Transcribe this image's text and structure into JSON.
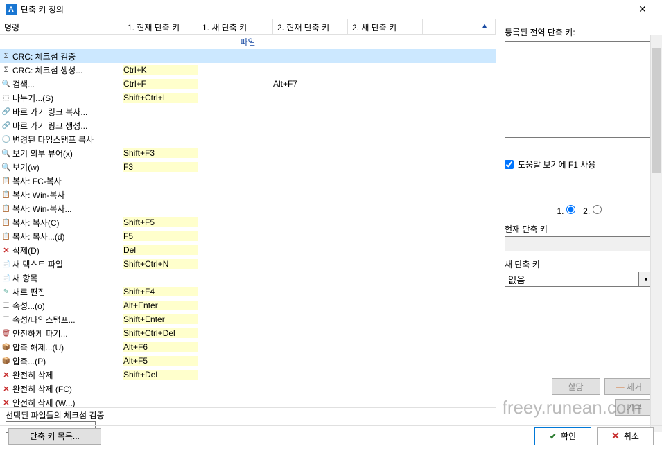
{
  "window": {
    "title": "단축 키 정의"
  },
  "headers": {
    "name": "명령",
    "c1current": "1. 현재 단축 키",
    "c1new": "1. 새 단축 키",
    "c2current": "2. 현재 단축 키",
    "c2new": "2. 새 단축 키"
  },
  "group": "파일",
  "rows": [
    {
      "icon": "sigma",
      "name": "CRC: 체크섬 검증",
      "c1c": "",
      "c1n": "",
      "c2c": "",
      "c2n": "",
      "selected": true
    },
    {
      "icon": "sigma",
      "name": "CRC: 체크섬 생성...",
      "c1c": "Ctrl+K",
      "c1n": "",
      "c2c": "",
      "c2n": ""
    },
    {
      "icon": "search",
      "name": "검색...",
      "c1c": "Ctrl+F",
      "c1n": "",
      "c2c": "Alt+F7",
      "c2n": ""
    },
    {
      "icon": "split",
      "name": "나누기...(S)",
      "c1c": "Shift+Ctrl+I",
      "c1n": "",
      "c2c": "",
      "c2n": ""
    },
    {
      "icon": "link",
      "name": "바로 가기 링크 복사...",
      "c1c": "",
      "c1n": "",
      "c2c": "",
      "c2n": ""
    },
    {
      "icon": "link",
      "name": "바로 가기 링크 생성...",
      "c1c": "",
      "c1n": "",
      "c2c": "",
      "c2n": ""
    },
    {
      "icon": "clock",
      "name": "변경된 타임스탬프 복사",
      "c1c": "",
      "c1n": "",
      "c2c": "",
      "c2n": ""
    },
    {
      "icon": "mag",
      "name": "보기 외부 뷰어(x)",
      "c1c": "Shift+F3",
      "c1n": "",
      "c2c": "",
      "c2n": ""
    },
    {
      "icon": "mag",
      "name": "보기(w)",
      "c1c": "F3",
      "c1n": "",
      "c2c": "",
      "c2n": ""
    },
    {
      "icon": "copy",
      "name": "복사: FC-복사",
      "c1c": "",
      "c1n": "",
      "c2c": "",
      "c2n": ""
    },
    {
      "icon": "copy",
      "name": "복사: Win-복사",
      "c1c": "",
      "c1n": "",
      "c2c": "",
      "c2n": ""
    },
    {
      "icon": "copy",
      "name": "복사: Win-복사...",
      "c1c": "",
      "c1n": "",
      "c2c": "",
      "c2n": ""
    },
    {
      "icon": "copy",
      "name": "복사: 복사(C)",
      "c1c": "Shift+F5",
      "c1n": "",
      "c2c": "",
      "c2n": ""
    },
    {
      "icon": "copy",
      "name": "복사: 복사...(d)",
      "c1c": "F5",
      "c1n": "",
      "c2c": "",
      "c2n": ""
    },
    {
      "icon": "del",
      "name": "삭제(D)",
      "c1c": "Del",
      "c1n": "",
      "c2c": "",
      "c2n": ""
    },
    {
      "icon": "file",
      "name": "새 텍스트 파일",
      "c1c": "Shift+Ctrl+N",
      "c1n": "",
      "c2c": "",
      "c2n": ""
    },
    {
      "icon": "file",
      "name": "새 항목",
      "c1c": "",
      "c1n": "",
      "c2c": "",
      "c2n": ""
    },
    {
      "icon": "edit",
      "name": "새로 편집",
      "c1c": "Shift+F4",
      "c1n": "",
      "c2c": "",
      "c2n": ""
    },
    {
      "icon": "prop",
      "name": "속성...(o)",
      "c1c": "Alt+Enter",
      "c1n": "",
      "c2c": "",
      "c2n": ""
    },
    {
      "icon": "prop",
      "name": "속성/타임스탬프...",
      "c1c": "Shift+Enter",
      "c1n": "",
      "c2c": "",
      "c2n": ""
    },
    {
      "icon": "shred",
      "name": "안전하게 파기...",
      "c1c": "Shift+Ctrl+Del",
      "c1n": "",
      "c2c": "",
      "c2n": ""
    },
    {
      "icon": "zip",
      "name": "압축 해제...(U)",
      "c1c": "Alt+F6",
      "c1n": "",
      "c2c": "",
      "c2n": ""
    },
    {
      "icon": "zip",
      "name": "압축...(P)",
      "c1c": "Alt+F5",
      "c1n": "",
      "c2c": "",
      "c2n": ""
    },
    {
      "icon": "del",
      "name": "완전히 삭제",
      "c1c": "Shift+Del",
      "c1n": "",
      "c2c": "",
      "c2n": ""
    },
    {
      "icon": "del",
      "name": "완전히 삭제 (FC)",
      "c1c": "",
      "c1n": "",
      "c2c": "",
      "c2n": ""
    },
    {
      "icon": "del",
      "name": "안전히 삭제 (W...)",
      "c1c": "",
      "c1n": "",
      "c2c": "",
      "c2n": ""
    }
  ],
  "status": "선택된 파일들의 체크섬 검증",
  "right": {
    "registered_label": "등록된 전역 단축 키:",
    "help_f1": "도움말 보기에 F1 사용",
    "radio1": "1.",
    "radio2": "2.",
    "current_label": "현재 단축 키",
    "current_value": "",
    "new_label": "새 단축 키",
    "new_value": "없음",
    "assign": "할당",
    "remove": "제거",
    "default": "기본"
  },
  "bottom": {
    "list_btn": "단축 키 목록...",
    "ok": "확인",
    "cancel": "취소"
  },
  "watermark": "freey.runean.com",
  "icons": {
    "sigma": "Σ",
    "search": "🔍",
    "split": "⬚",
    "link": "🔗",
    "clock": "🕘",
    "mag": "🔍",
    "copy": "📋",
    "del": "✕",
    "file": "📄",
    "edit": "✎",
    "prop": "☰",
    "shred": "🗑",
    "zip": "📦"
  }
}
